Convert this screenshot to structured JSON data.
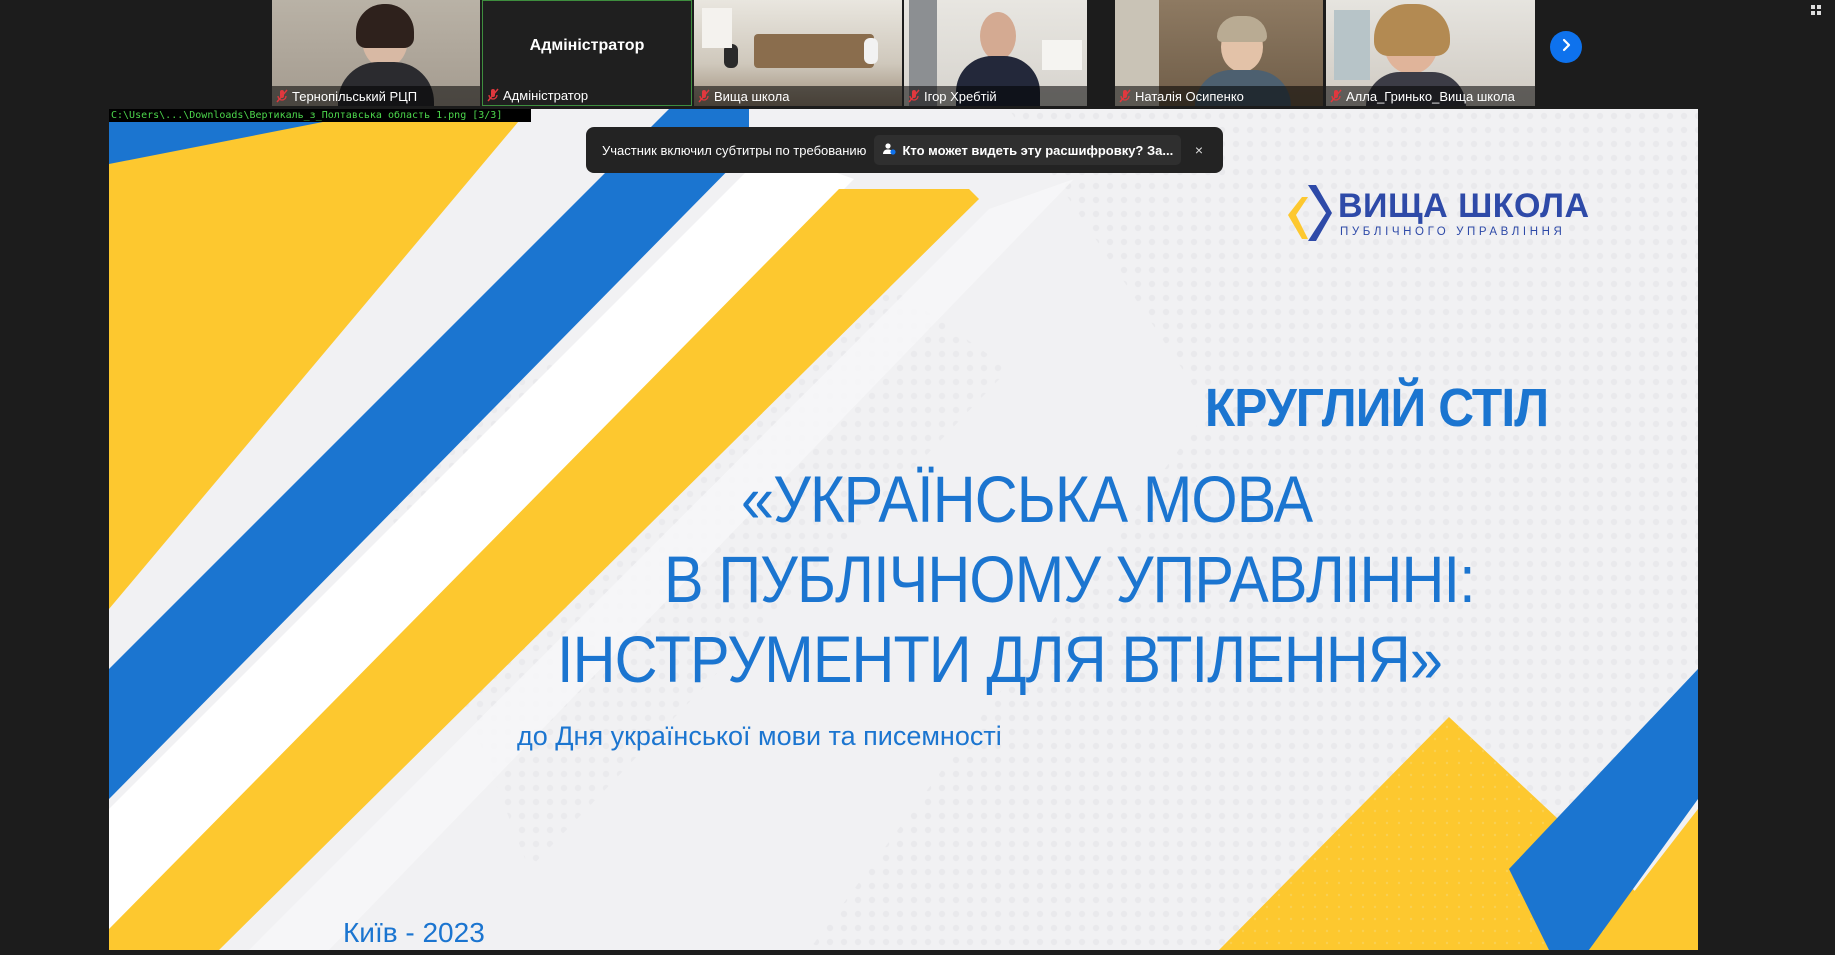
{
  "participants": [
    {
      "name": "Тернопільський РЦП",
      "muted": true
    },
    {
      "name": "Адміністратор",
      "muted": true,
      "center_label": "Адміністратор"
    },
    {
      "name": "Вища школа",
      "muted": true
    },
    {
      "name": "Ігор Хребтій",
      "muted": true
    },
    {
      "name": "Наталія Осипенко",
      "muted": true
    },
    {
      "name": "Алла_Гринько_Вища школа",
      "muted": true
    }
  ],
  "file_path": "C:\\Users\\...\\Downloads\\Вертикаль_з_Полтавська область 1.png [3/3]",
  "caption_toast": {
    "message": "Участник включил субтитры по требованию",
    "link_label": "Кто может видеть эту расшифровку? За...",
    "close": "×"
  },
  "slide": {
    "logo_main": "ВИЩА ШКОЛА",
    "logo_sub": "ПУБЛІЧНОГО УПРАВЛІННЯ",
    "kicker": "КРУГЛИЙ СТІЛ",
    "title_lines": [
      "«УКРАЇНСЬКА МОВА",
      "В ПУБЛІЧНОМУ УПРАВЛІННІ:",
      "ІНСТРУМЕНТИ ДЛЯ ВТІЛЕННЯ»"
    ],
    "subtitle": "до Дня української мови та писемності",
    "place": "Київ - 2023"
  },
  "colors": {
    "blue": "#1b75d0",
    "yellow": "#fdc82f",
    "logo_blue": "#2e4aa8",
    "zoom_blue": "#0e72ed",
    "mute_red": "#e0383e"
  }
}
